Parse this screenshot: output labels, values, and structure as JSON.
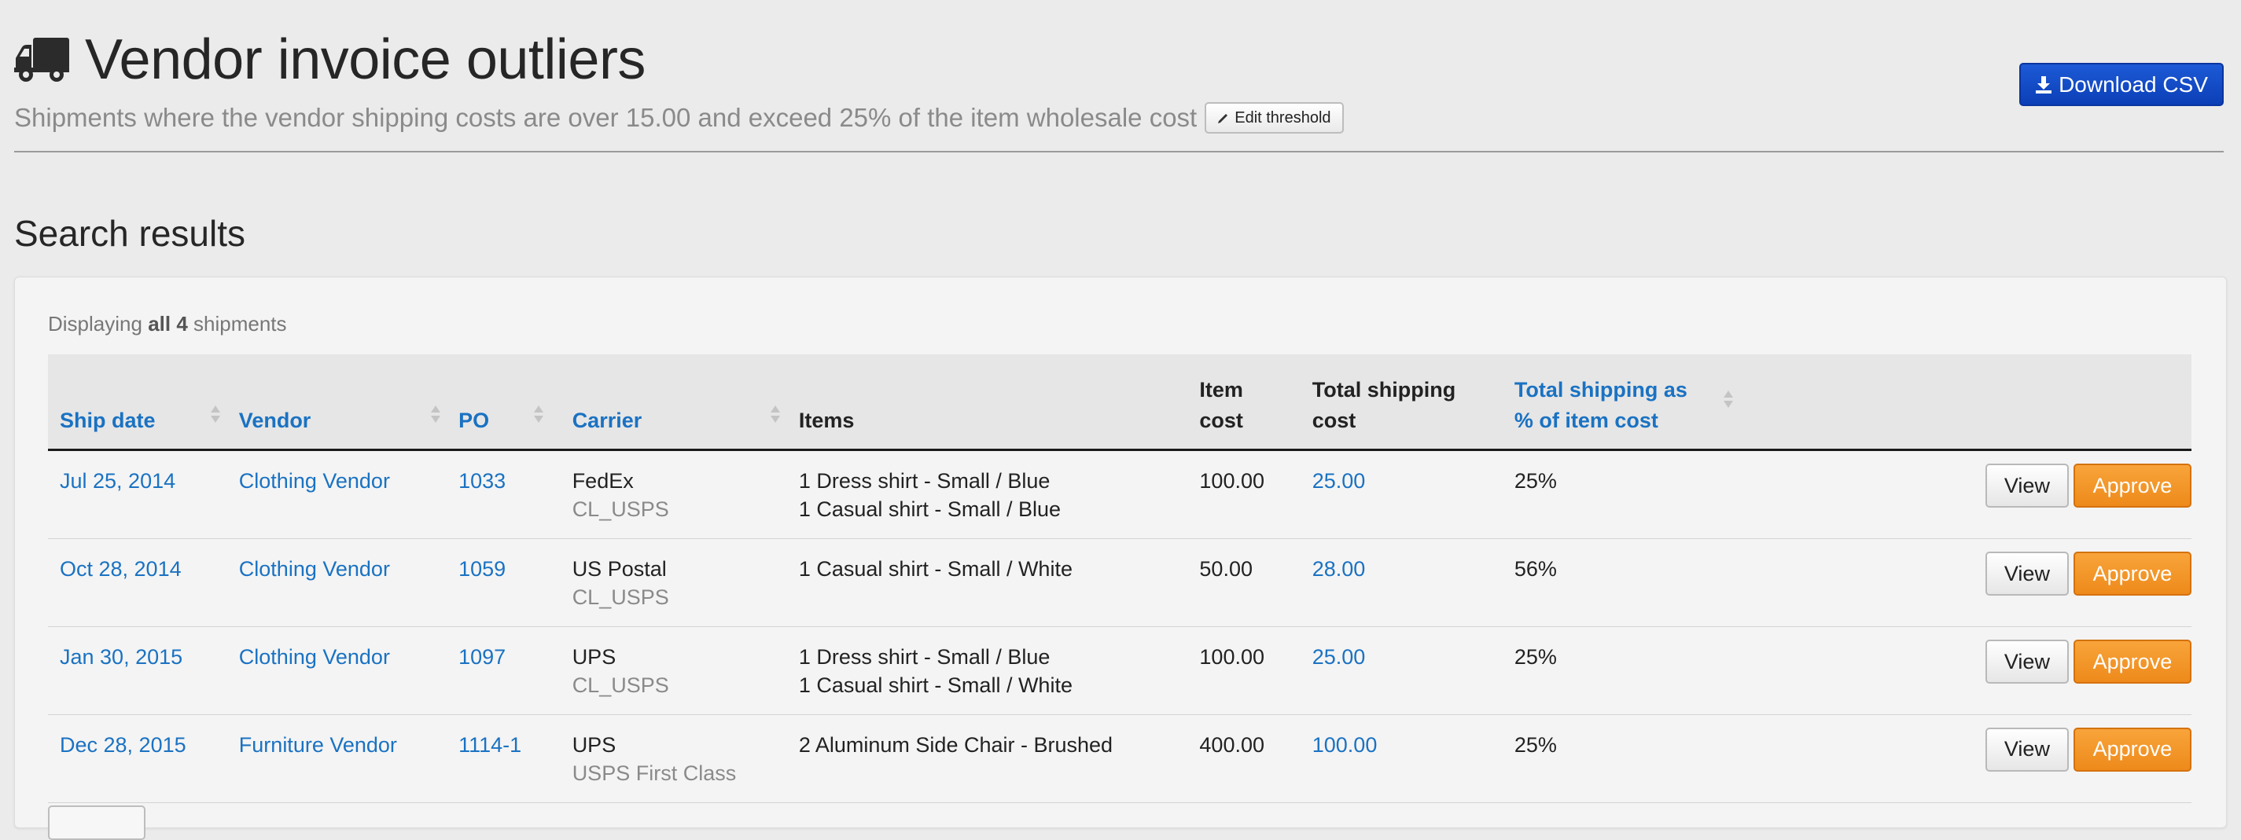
{
  "header": {
    "title": "Vendor invoice outliers",
    "subtitle": "Shipments where the vendor shipping costs are over 15.00 and exceed 25% of the item wholesale cost",
    "edit_threshold_label": "Edit threshold",
    "download_label": "Download CSV",
    "icon": "truck-icon"
  },
  "results": {
    "section_title": "Search results",
    "displaying_prefix": "Displaying",
    "displaying_bold": "all 4",
    "displaying_suffix": "shipments",
    "columns": {
      "ship_date": "Ship date",
      "vendor": "Vendor",
      "po": "PO",
      "carrier": "Carrier",
      "items": "Items",
      "item_cost_l1": "Item",
      "item_cost_l2": "cost",
      "total_shipping_l1": "Total shipping",
      "total_shipping_l2": "cost",
      "pct_l1": "Total shipping as",
      "pct_l2": "% of item cost"
    },
    "rows": [
      {
        "ship_date": "Jul 25, 2014",
        "vendor": "Clothing Vendor",
        "po": "1033",
        "carrier": "FedEx",
        "carrier_service": "CL_USPS",
        "item1": "1 Dress shirt - Small / Blue",
        "item2": "1 Casual shirt - Small / Blue",
        "item_cost": "100.00",
        "total_shipping": "25.00",
        "pct": "25%",
        "view_label": "View",
        "approve_label": "Approve"
      },
      {
        "ship_date": "Oct 28, 2014",
        "vendor": "Clothing Vendor",
        "po": "1059",
        "carrier": "US Postal",
        "carrier_service": "CL_USPS",
        "item1": "1 Casual shirt - Small / White",
        "item2": "",
        "item_cost": "50.00",
        "total_shipping": "28.00",
        "pct": "56%",
        "view_label": "View",
        "approve_label": "Approve"
      },
      {
        "ship_date": "Jan 30, 2015",
        "vendor": "Clothing Vendor",
        "po": "1097",
        "carrier": "UPS",
        "carrier_service": "CL_USPS",
        "item1": "1 Dress shirt - Small / Blue",
        "item2": "1 Casual shirt - Small / White",
        "item_cost": "100.00",
        "total_shipping": "25.00",
        "pct": "25%",
        "view_label": "View",
        "approve_label": "Approve"
      },
      {
        "ship_date": "Dec 28, 2015",
        "vendor": "Furniture Vendor",
        "po": "1114-1",
        "carrier": "UPS",
        "carrier_service": "USPS First Class",
        "item1": "2 Aluminum Side Chair - Brushed",
        "item2": "",
        "item_cost": "400.00",
        "total_shipping": "100.00",
        "pct": "25%",
        "view_label": "View",
        "approve_label": "Approve"
      }
    ]
  },
  "colors": {
    "link": "#1a72c2",
    "primary_button": "#0b3fb7",
    "approve_button": "#f39a2a",
    "background": "#ebebeb"
  }
}
